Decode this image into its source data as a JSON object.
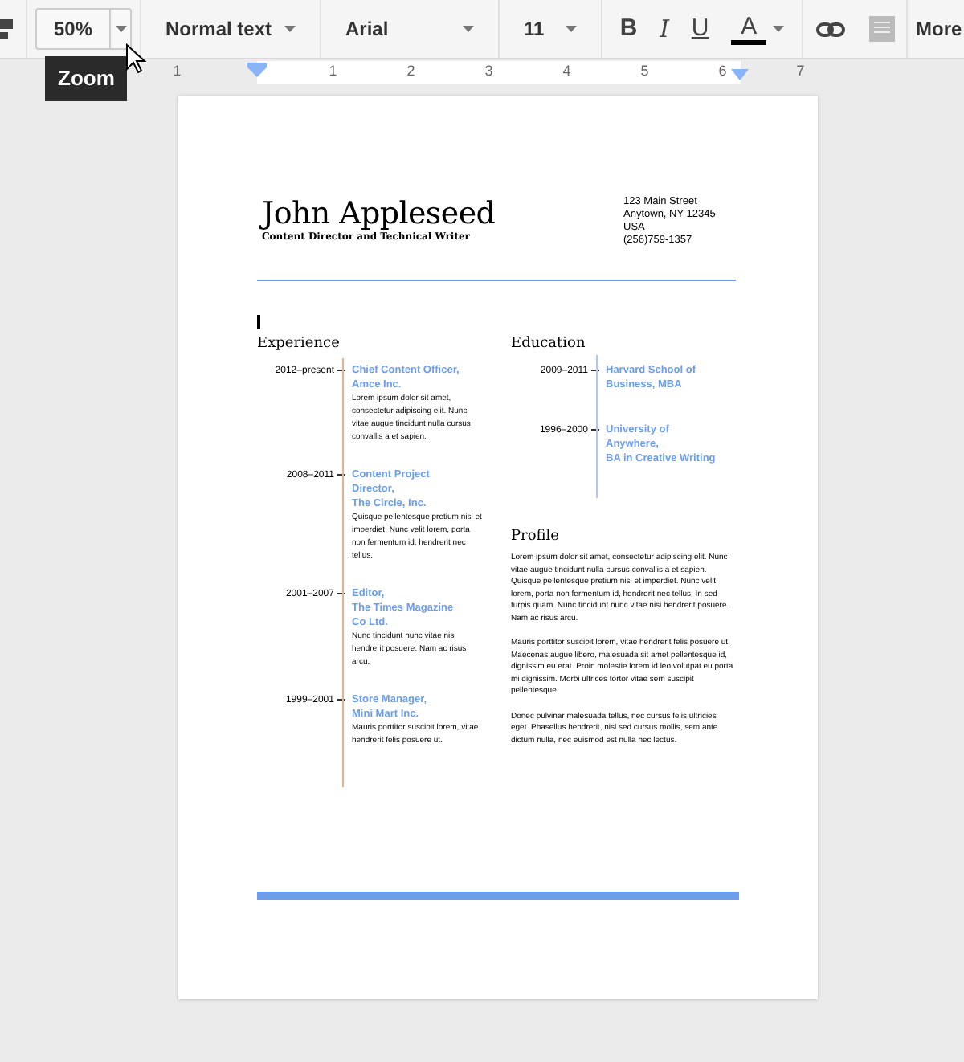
{
  "toolbar": {
    "zoom": "50%",
    "style": "Normal text",
    "font": "Arial",
    "size": "11",
    "format_buttons": [
      {
        "kind": "bold",
        "label": "B"
      },
      {
        "kind": "italic",
        "label": "I"
      },
      {
        "kind": "underline",
        "label": "U"
      },
      {
        "kind": "color",
        "label": "A",
        "color": "#000000"
      }
    ],
    "comment_disabled": true,
    "more": "More"
  },
  "tooltip": "Zoom",
  "ruler": {
    "labels": [
      "1",
      "1",
      "2",
      "3",
      "4",
      "5",
      "6",
      "7"
    ]
  },
  "document": {
    "name": "John Appleseed",
    "subtitle": "Content Director and Technical Writer",
    "address": [
      "123 Main Street",
      "Anytown, NY 12345",
      "USA",
      "(256)759-1357"
    ],
    "experience": {
      "heading": "Experience",
      "entries": [
        {
          "dates": "2012–present",
          "title": [
            "Chief Content Officer,",
            "Amce Inc."
          ],
          "body": "Lorem ipsum dolor sit amet, consectetur adipiscing elit. Nunc vitae augue tincidunt nulla cursus convallis a et sapien."
        },
        {
          "dates": "2008–2011",
          "title": [
            "Content Project",
            "Director,",
            "The Circle, Inc."
          ],
          "body": "Quisque pellentesque pretium nisl et imperdiet. Nunc velit lorem, porta non fermentum id, hendrerit nec tellus."
        },
        {
          "dates": "2001–2007",
          "title": [
            "Editor,",
            "The Times Magazine",
            "Co Ltd."
          ],
          "body": "Nunc tincidunt nunc vitae nisi hendrerit posuere. Nam ac risus arcu."
        },
        {
          "dates": "1999–2001",
          "title": [
            "Store Manager,",
            "Mini Mart Inc."
          ],
          "body": "Mauris porttitor suscipit lorem, vitae hendrerit felis posuere ut."
        }
      ]
    },
    "education": {
      "heading": "Education",
      "entries": [
        {
          "dates": "2009–2011",
          "title": [
            "Harvard School of",
            "Business, MBA"
          ]
        },
        {
          "dates": "1996–2000",
          "title": [
            "University of",
            "Anywhere,",
            "BA in Creative Writing"
          ]
        }
      ]
    },
    "profile": {
      "heading": "Profile",
      "paragraphs": [
        "Lorem ipsum dolor sit amet, consectetur adipiscing elit. Nunc vitae augue tincidunt nulla cursus convallis a et sapien. Quisque pellentesque pretium nisl et imperdiet. Nunc velit lorem, porta non fermentum id, hendrerit nec tellus. In sed turpis quam. Nunc tincidunt nunc vitae nisi hendrerit posuere. Nam ac risus arcu.",
        "Mauris porttitor suscipit lorem, vitae hendrerit felis posuere ut. Maecenas augue libero, malesuada sit amet pellentesque id, dignissim eu erat. Proin molestie lorem id leo volutpat eu porta mi dignissim. Morbi ultrices tortor vitae sem suscipit pellentesque.",
        "Donec pulvinar malesuada tellus, nec cursus felis ultricies eget. Phasellus hendrerit, nisl sed cursus mollis, sem ante dictum nulla, nec euismod est nulla nec lectus."
      ]
    }
  }
}
